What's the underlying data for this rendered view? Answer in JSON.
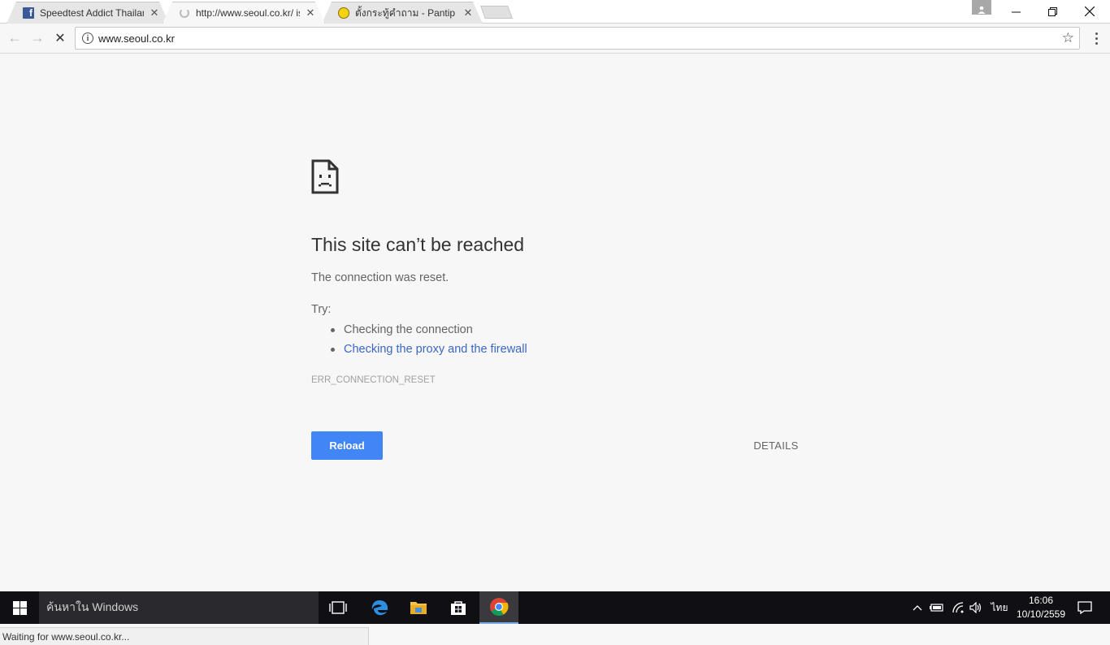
{
  "window": {
    "tabs": [
      {
        "title": "Speedtest Addict Thailand",
        "icon": "facebook-icon",
        "close": "✕"
      },
      {
        "title": "http://www.seoul.co.kr/ is loading",
        "icon": "loading-spinner-icon",
        "close": "✕"
      },
      {
        "title": "ตั้งกระทู้คำถาม - Pantip",
        "icon": "pantip-smiley-icon",
        "close": "✕"
      }
    ],
    "controls": {
      "minimize": "—",
      "restore": "❐",
      "close": "✕"
    }
  },
  "toolbar": {
    "back": "←",
    "forward": "→",
    "stop": "✕",
    "url": "www.seoul.co.kr",
    "info": "i",
    "bookmark": "☆"
  },
  "error_page": {
    "title": "This site can’t be reached",
    "message": "The connection was reset.",
    "try_label": "Try:",
    "suggestions": [
      {
        "text": "Checking the connection",
        "link": false
      },
      {
        "text": "Checking the proxy and the firewall",
        "link": true
      }
    ],
    "error_code": "ERR_CONNECTION_RESET",
    "reload_label": "Reload",
    "details_label": "DETAILS"
  },
  "status_bar": "Waiting for www.seoul.co.kr...",
  "taskbar": {
    "search_placeholder": "ค้นหาใน Windows",
    "language": "ไทย",
    "time": "16:06",
    "date": "10/10/2559",
    "accent_color": "#76a9e6"
  },
  "colors": {
    "reload_button": "#4285f4",
    "link": "#3b66c3",
    "page_background": "#f7f7f7"
  }
}
